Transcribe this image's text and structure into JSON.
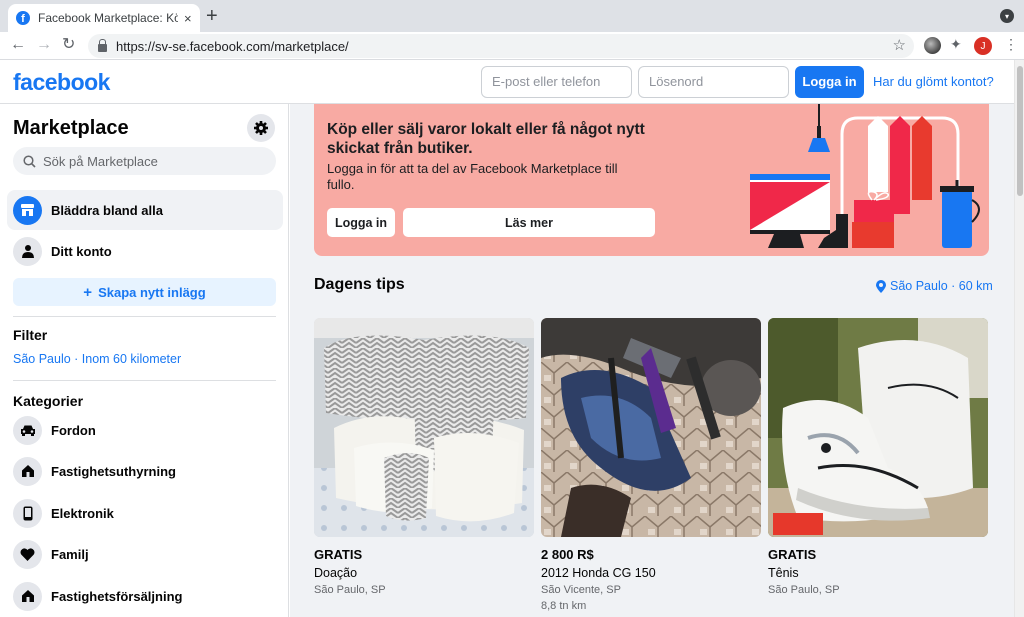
{
  "browser": {
    "tab_title": "Facebook Marketplace: Köp och sälj",
    "tab_close": "×",
    "new_tab": "+",
    "url": "https://sv-se.facebook.com/marketplace/",
    "profile_initial": "J"
  },
  "header": {
    "logo": "facebook",
    "email_placeholder": "E-post eller telefon",
    "password_placeholder": "Lösenord",
    "login_label": "Logga in",
    "forgot_label": "Har du glömt kontot?"
  },
  "sidebar": {
    "title": "Marketplace",
    "search_placeholder": "Sök på Marketplace",
    "nav": [
      {
        "label": "Bläddra bland alla"
      },
      {
        "label": "Ditt konto"
      }
    ],
    "create_label": "Skapa nytt inlägg",
    "filter_heading": "Filter",
    "filter_value": "São Paulo · Inom 60 kilometer",
    "categories_heading": "Kategorier",
    "categories": [
      {
        "label": "Fordon",
        "icon": "car-icon"
      },
      {
        "label": "Fastighetsuthyrning",
        "icon": "house-icon"
      },
      {
        "label": "Elektronik",
        "icon": "phone-icon"
      },
      {
        "label": "Familj",
        "icon": "heart-icon"
      },
      {
        "label": "Fastighetsförsäljning",
        "icon": "house-icon"
      }
    ]
  },
  "banner": {
    "headline": "Köp eller sälj varor lokalt eller få något nytt skickat från butiker.",
    "subtext": "Logga in för att ta del av Facebook Marketplace till fullo.",
    "login_label": "Logga in",
    "learn_more_label": "Läs mer"
  },
  "tips": {
    "heading": "Dagens tips",
    "location": "São Paulo · 60 km"
  },
  "listings": [
    {
      "price": "GRATIS",
      "title": "Doação",
      "location": "São Paulo, SP",
      "distance": ""
    },
    {
      "price": "2 800 R$",
      "title": "2012 Honda CG 150",
      "location": "São Vicente, SP",
      "distance": "8,8 tn km"
    },
    {
      "price": "GRATIS",
      "title": "Tênis",
      "location": "São Paulo, SP",
      "distance": ""
    }
  ],
  "colors": {
    "brand": "#1877f2",
    "banner": "#f8aaa3",
    "background": "#f0f2f5"
  }
}
